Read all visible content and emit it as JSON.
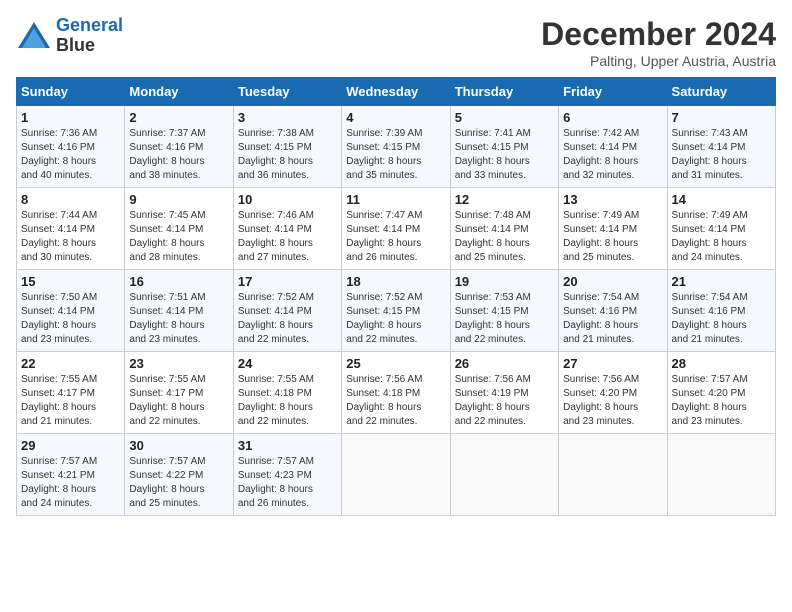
{
  "header": {
    "logo_line1": "General",
    "logo_line2": "Blue",
    "month": "December 2024",
    "location": "Palting, Upper Austria, Austria"
  },
  "days_of_week": [
    "Sunday",
    "Monday",
    "Tuesday",
    "Wednesday",
    "Thursday",
    "Friday",
    "Saturday"
  ],
  "weeks": [
    [
      {
        "day": 1,
        "sunrise": "7:36 AM",
        "sunset": "4:16 PM",
        "daylight": "8 hours and 40 minutes."
      },
      {
        "day": 2,
        "sunrise": "7:37 AM",
        "sunset": "4:16 PM",
        "daylight": "8 hours and 38 minutes."
      },
      {
        "day": 3,
        "sunrise": "7:38 AM",
        "sunset": "4:15 PM",
        "daylight": "8 hours and 36 minutes."
      },
      {
        "day": 4,
        "sunrise": "7:39 AM",
        "sunset": "4:15 PM",
        "daylight": "8 hours and 35 minutes."
      },
      {
        "day": 5,
        "sunrise": "7:41 AM",
        "sunset": "4:15 PM",
        "daylight": "8 hours and 33 minutes."
      },
      {
        "day": 6,
        "sunrise": "7:42 AM",
        "sunset": "4:14 PM",
        "daylight": "8 hours and 32 minutes."
      },
      {
        "day": 7,
        "sunrise": "7:43 AM",
        "sunset": "4:14 PM",
        "daylight": "8 hours and 31 minutes."
      }
    ],
    [
      {
        "day": 8,
        "sunrise": "7:44 AM",
        "sunset": "4:14 PM",
        "daylight": "8 hours and 30 minutes."
      },
      {
        "day": 9,
        "sunrise": "7:45 AM",
        "sunset": "4:14 PM",
        "daylight": "8 hours and 28 minutes."
      },
      {
        "day": 10,
        "sunrise": "7:46 AM",
        "sunset": "4:14 PM",
        "daylight": "8 hours and 27 minutes."
      },
      {
        "day": 11,
        "sunrise": "7:47 AM",
        "sunset": "4:14 PM",
        "daylight": "8 hours and 26 minutes."
      },
      {
        "day": 12,
        "sunrise": "7:48 AM",
        "sunset": "4:14 PM",
        "daylight": "8 hours and 25 minutes."
      },
      {
        "day": 13,
        "sunrise": "7:49 AM",
        "sunset": "4:14 PM",
        "daylight": "8 hours and 25 minutes."
      },
      {
        "day": 14,
        "sunrise": "7:49 AM",
        "sunset": "4:14 PM",
        "daylight": "8 hours and 24 minutes."
      }
    ],
    [
      {
        "day": 15,
        "sunrise": "7:50 AM",
        "sunset": "4:14 PM",
        "daylight": "8 hours and 23 minutes."
      },
      {
        "day": 16,
        "sunrise": "7:51 AM",
        "sunset": "4:14 PM",
        "daylight": "8 hours and 23 minutes."
      },
      {
        "day": 17,
        "sunrise": "7:52 AM",
        "sunset": "4:14 PM",
        "daylight": "8 hours and 22 minutes."
      },
      {
        "day": 18,
        "sunrise": "7:52 AM",
        "sunset": "4:15 PM",
        "daylight": "8 hours and 22 minutes."
      },
      {
        "day": 19,
        "sunrise": "7:53 AM",
        "sunset": "4:15 PM",
        "daylight": "8 hours and 22 minutes."
      },
      {
        "day": 20,
        "sunrise": "7:54 AM",
        "sunset": "4:16 PM",
        "daylight": "8 hours and 21 minutes."
      },
      {
        "day": 21,
        "sunrise": "7:54 AM",
        "sunset": "4:16 PM",
        "daylight": "8 hours and 21 minutes."
      }
    ],
    [
      {
        "day": 22,
        "sunrise": "7:55 AM",
        "sunset": "4:17 PM",
        "daylight": "8 hours and 21 minutes."
      },
      {
        "day": 23,
        "sunrise": "7:55 AM",
        "sunset": "4:17 PM",
        "daylight": "8 hours and 22 minutes."
      },
      {
        "day": 24,
        "sunrise": "7:55 AM",
        "sunset": "4:18 PM",
        "daylight": "8 hours and 22 minutes."
      },
      {
        "day": 25,
        "sunrise": "7:56 AM",
        "sunset": "4:18 PM",
        "daylight": "8 hours and 22 minutes."
      },
      {
        "day": 26,
        "sunrise": "7:56 AM",
        "sunset": "4:19 PM",
        "daylight": "8 hours and 22 minutes."
      },
      {
        "day": 27,
        "sunrise": "7:56 AM",
        "sunset": "4:20 PM",
        "daylight": "8 hours and 23 minutes."
      },
      {
        "day": 28,
        "sunrise": "7:57 AM",
        "sunset": "4:20 PM",
        "daylight": "8 hours and 23 minutes."
      }
    ],
    [
      {
        "day": 29,
        "sunrise": "7:57 AM",
        "sunset": "4:21 PM",
        "daylight": "8 hours and 24 minutes."
      },
      {
        "day": 30,
        "sunrise": "7:57 AM",
        "sunset": "4:22 PM",
        "daylight": "8 hours and 25 minutes."
      },
      {
        "day": 31,
        "sunrise": "7:57 AM",
        "sunset": "4:23 PM",
        "daylight": "8 hours and 26 minutes."
      },
      null,
      null,
      null,
      null
    ]
  ]
}
